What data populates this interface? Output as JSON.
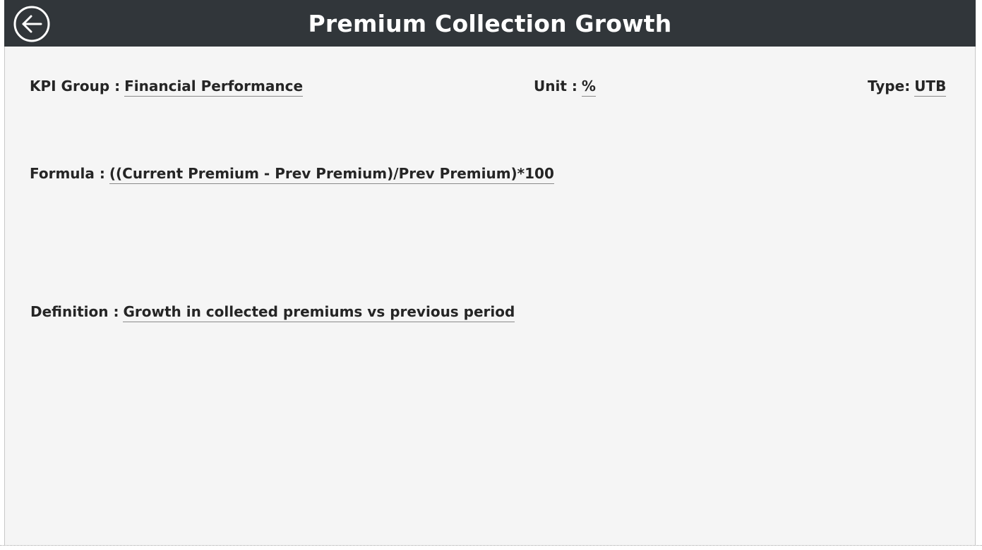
{
  "header": {
    "title": "Premium Collection Growth",
    "back_icon": "arrow-left-circle-icon",
    "background": "#31363a"
  },
  "fields": {
    "kpi_group": {
      "label": "KPI Group :",
      "value": "Financial Performance"
    },
    "unit": {
      "label": "Unit :",
      "value": "%"
    },
    "type": {
      "label": "Type:",
      "value": "UTB"
    },
    "formula": {
      "label": "Formula :",
      "value": "((Current Premium - Prev Premium)/Prev Premium)*100"
    },
    "definition": {
      "label": "Definition :",
      "value": "Growth in collected premiums vs previous period"
    }
  },
  "colors": {
    "canvas": "#f5f5f5",
    "text": "#252525",
    "title_text": "#ffffff"
  }
}
